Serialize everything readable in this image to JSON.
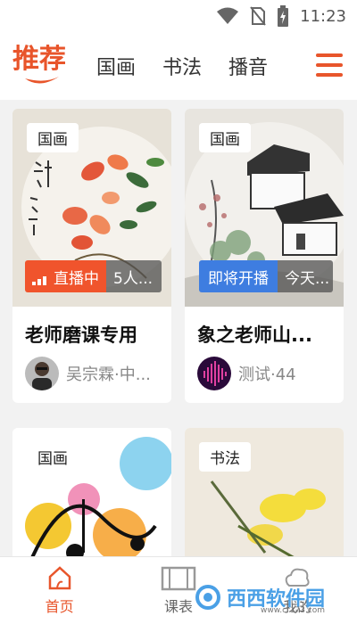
{
  "status_bar": {
    "time": "11:23",
    "icons": [
      "wifi-icon",
      "no-sim-icon",
      "battery-charging-icon"
    ]
  },
  "header": {
    "logo_text": "推荐",
    "tabs": [
      {
        "label": "国画"
      },
      {
        "label": "书法"
      },
      {
        "label": "播音"
      }
    ],
    "menu_icon": "hamburger-menu-icon",
    "accent_color": "#e8552b"
  },
  "cards": [
    {
      "category": "国画",
      "status_label": "直播中",
      "status_color": "#f0542c",
      "audience": "5人...",
      "title": "老师磨课专用",
      "teacher": "吴宗霖·中..."
    },
    {
      "category": "国画",
      "status_label": "即将开播",
      "status_color": "#3e7de0",
      "audience": "今天...",
      "title": "象之老师山...",
      "teacher": "测试·44"
    },
    {
      "category": "国画"
    },
    {
      "category": "书法"
    }
  ],
  "bottom_nav": {
    "items": [
      {
        "label": "首页",
        "icon": "home-icon",
        "active": true
      },
      {
        "label": "课表",
        "icon": "schedule-icon",
        "active": false
      },
      {
        "label": "我的",
        "icon": "profile-icon",
        "active": false
      }
    ]
  },
  "watermark": {
    "text": "西西软件园",
    "url": "www.cr173.com"
  }
}
